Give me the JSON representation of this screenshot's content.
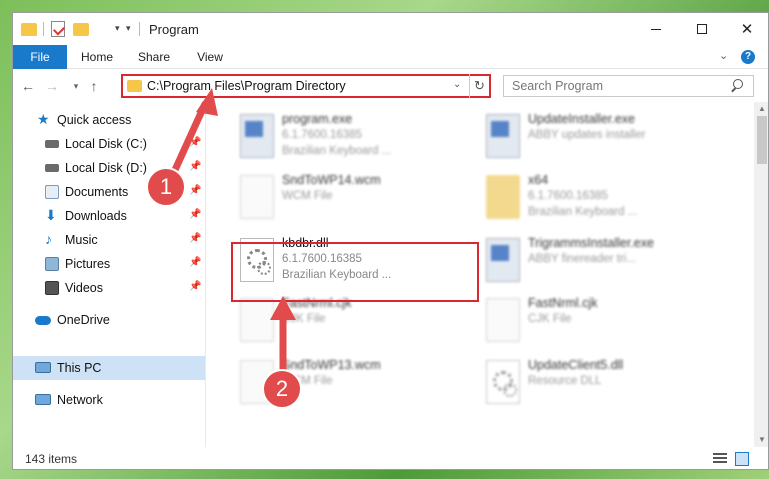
{
  "window": {
    "title": "Program"
  },
  "ribbon": {
    "tabs": [
      {
        "label": "File"
      },
      {
        "label": "Home"
      },
      {
        "label": "Share"
      },
      {
        "label": "View"
      }
    ],
    "help_label": "?"
  },
  "navigation": {
    "address": "C:\\Program Files\\Program Directory",
    "search_placeholder": "Search Program"
  },
  "sidebar": {
    "items": [
      {
        "label": "Quick access",
        "icon": "star-icon"
      },
      {
        "label": "Local Disk (C:)",
        "icon": "drive-icon",
        "pinned": true
      },
      {
        "label": "Local Disk (D:)",
        "icon": "drive-icon",
        "pinned": true
      },
      {
        "label": "Documents",
        "icon": "documents-icon",
        "pinned": true
      },
      {
        "label": "Downloads",
        "icon": "download-icon",
        "pinned": true
      },
      {
        "label": "Music",
        "icon": "music-icon",
        "pinned": true
      },
      {
        "label": "Pictures",
        "icon": "pictures-icon",
        "pinned": true
      },
      {
        "label": "Videos",
        "icon": "videos-icon",
        "pinned": true
      },
      {
        "label": "OneDrive",
        "icon": "cloud-icon"
      },
      {
        "label": "This PC",
        "icon": "computer-icon",
        "selected": true
      },
      {
        "label": "Network",
        "icon": "network-icon"
      }
    ]
  },
  "files": [
    {
      "name": "program.exe",
      "line1": "6.1.7600.16385",
      "line2": "Brazilian Keyboard ...",
      "icon": "exe-icon"
    },
    {
      "name": "UpdateInstaller.exe",
      "line1": "ABBY updates installer",
      "line2": "",
      "icon": "exe-icon"
    },
    {
      "name": "SndToWP14.wcm",
      "line1": "WCM File",
      "line2": "",
      "icon": "document-icon"
    },
    {
      "name": "x64",
      "line1": "6.1.7600.16385",
      "line2": "Brazilian Keyboard ...",
      "icon": "folder-icon"
    },
    {
      "name": "kbdbr.dll",
      "line1": "6.1.7600.16385",
      "line2": "Brazilian Keyboard ...",
      "icon": "dll-gear-icon"
    },
    {
      "name": "TrigrammsInstaller.exe",
      "line1": "ABBY finereader tri...",
      "line2": "",
      "icon": "exe-icon"
    },
    {
      "name": "FastNrml.cjk",
      "line1": "CJK File",
      "line2": "",
      "icon": "document-icon"
    },
    {
      "name": "FastNrml.cjk",
      "line1": "CJK File",
      "line2": "",
      "icon": "document-icon"
    },
    {
      "name": "SndToWP13.wcm",
      "line1": "WCM File",
      "line2": "",
      "icon": "document-icon"
    },
    {
      "name": "UpdateClient5.dll",
      "line1": "Resource DLL",
      "line2": "",
      "icon": "dll-gear-icon"
    }
  ],
  "status": {
    "item_count": "143 items"
  },
  "annotations": {
    "step1": "1",
    "step2": "2"
  },
  "colors": {
    "accent": "#1979ca",
    "highlight": "#d9282f",
    "annotation": "#e24b4b",
    "selected": "#cde2f5"
  }
}
